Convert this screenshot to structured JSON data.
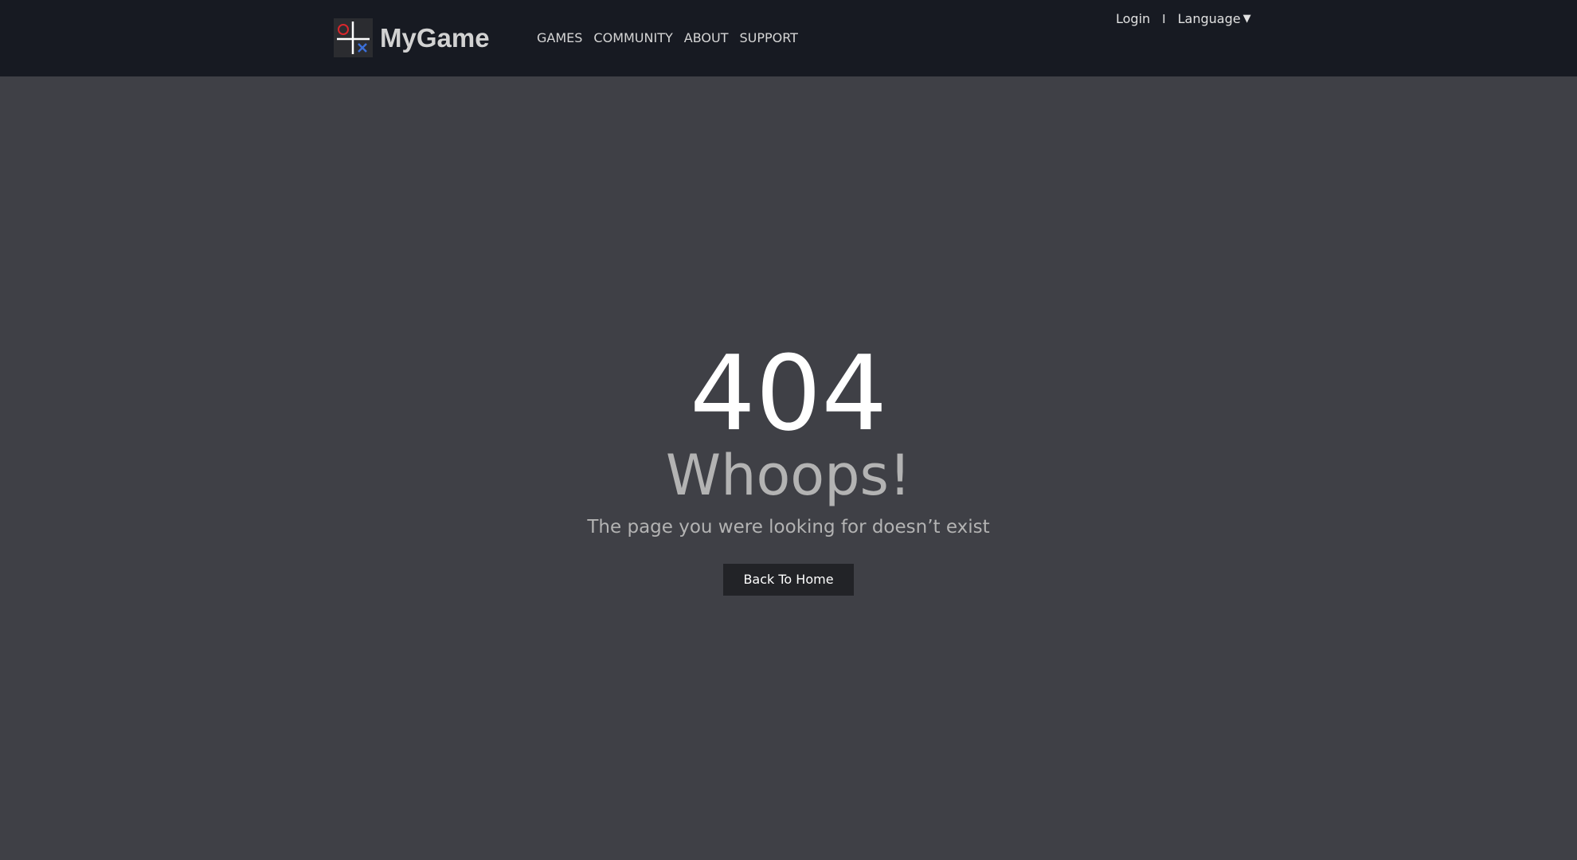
{
  "brand": {
    "name": "MyGame",
    "logo_icon": "tic-tac-toe-logo-icon",
    "colors": {
      "o_mark": "#d9262c",
      "x_mark": "#3b6fd8",
      "grid": "#ffffff"
    }
  },
  "nav": {
    "items": [
      "GAMES",
      "COMMUNITY",
      "ABOUT",
      "SUPPORT"
    ]
  },
  "account": {
    "login": "Login",
    "separator": "I",
    "language": "Language",
    "language_icon": "caret-down-icon"
  },
  "error": {
    "code": "404",
    "title": "Whoops!",
    "message": "The page you were looking for doesn’t exist",
    "button": "Back To Home"
  },
  "theme": {
    "header_bg": "#171a22",
    "page_bg": "#3f4046",
    "button_bg": "#222327"
  }
}
